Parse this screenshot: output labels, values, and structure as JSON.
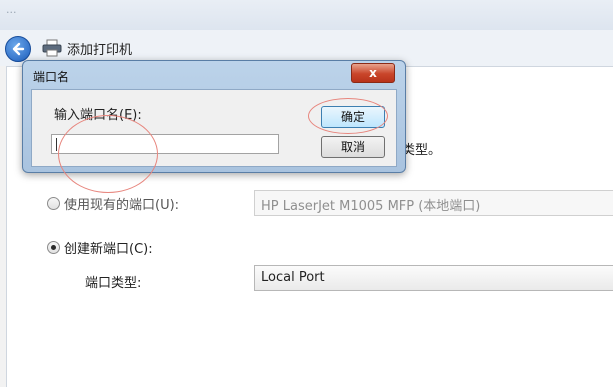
{
  "titlebar": {
    "faint_text": "···"
  },
  "wizard": {
    "title": "添加打印机",
    "hidden_type_fragment": "类型。"
  },
  "port_options": {
    "existing_label": "使用现有的端口(U):",
    "existing_value": "HP LaserJet M1005 MFP (本地端口)",
    "existing_checked": false,
    "new_label": "创建新端口(C):",
    "new_checked": true,
    "type_label": "端口类型:",
    "type_value": "Local Port"
  },
  "dialog": {
    "title": "端口名",
    "close_label": "x",
    "prompt": "输入端口名(E):",
    "input_value": "",
    "ok_label": "确定",
    "cancel_label": "取消"
  },
  "colors": {
    "annotation_circle": "#e7857d",
    "dialog_frame": "#a9c3df",
    "close_button": "#c9452a"
  }
}
